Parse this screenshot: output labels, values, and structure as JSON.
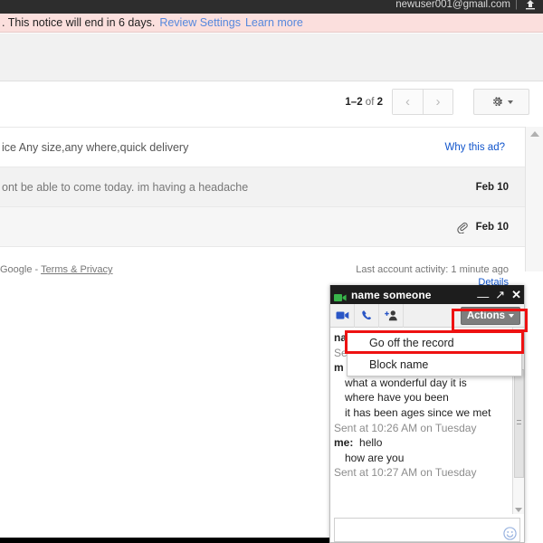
{
  "topbar": {
    "email": "newuser001@gmail.com",
    "separator": "|",
    "bell_icon": "bell-icon"
  },
  "notice": {
    "prefix": ".",
    "text": "This notice will end in 6 days.",
    "review_link": "Review Settings",
    "learn_link": "Learn more"
  },
  "pagination": {
    "range_start": "1–2",
    "range_mid": "of",
    "range_end": "2",
    "prev_icon": "‹",
    "next_icon": "›",
    "gear_icon": "gear-icon"
  },
  "maillist": {
    "rows": [
      {
        "snippet": "ice Any size,any where,quick delivery",
        "right_label": "Why this ad?",
        "kind": "ad",
        "attachment": false
      },
      {
        "snippet": "ont be able to come today. im having a headache",
        "right_label": "Feb 10",
        "kind": "read",
        "attachment": false
      },
      {
        "snippet": "",
        "right_label": "Feb 10",
        "kind": "read2",
        "attachment": true
      }
    ]
  },
  "footer": {
    "google": "Google -",
    "terms": "Terms & Privacy",
    "activity": "Last account activity: 1 minute ago",
    "details": "Details"
  },
  "chat": {
    "title": "name someone",
    "camera_icon": "video-camera-icon",
    "minimize_icon": "—",
    "popout_icon": "↗",
    "close_icon": "✕",
    "tools": [
      {
        "name": "video-call-icon"
      },
      {
        "name": "phone-call-icon"
      },
      {
        "name": "add-person-icon"
      }
    ],
    "actions_label": "Actions",
    "menu": [
      {
        "label": "Go off the record",
        "highlighted": true
      },
      {
        "label": "Block name",
        "highlighted": false
      }
    ],
    "messages": [
      {
        "who": "na",
        "text": "",
        "type": "name-clipped"
      },
      {
        "who": "",
        "text": "Se",
        "type": "ts-clipped"
      },
      {
        "who": "m",
        "text": "",
        "type": "name-clipped"
      },
      {
        "who": "",
        "text": "what a wonderful day it is",
        "type": "indent"
      },
      {
        "who": "",
        "text": "where have you been",
        "type": "indent"
      },
      {
        "who": "",
        "text": "it has been ages since we met",
        "type": "indent"
      },
      {
        "who": "",
        "text": "Sent at 10:26 AM on Tuesday",
        "type": "timestamp"
      },
      {
        "who": "me:",
        "text": "hello",
        "type": "msg"
      },
      {
        "who": "",
        "text": "how are you",
        "type": "indent"
      },
      {
        "who": "",
        "text": "Sent at 10:27 AM on Tuesday",
        "type": "timestamp"
      }
    ],
    "input_placeholder": "",
    "input_value": "",
    "smiley_icon": "smiley-icon"
  },
  "colors": {
    "notice_bg": "#fbdfdd",
    "link": "#5588dd",
    "highlight": "#ee1111",
    "chat_header": "#1d1d1d",
    "actions_btn": "#7e7e7e"
  }
}
